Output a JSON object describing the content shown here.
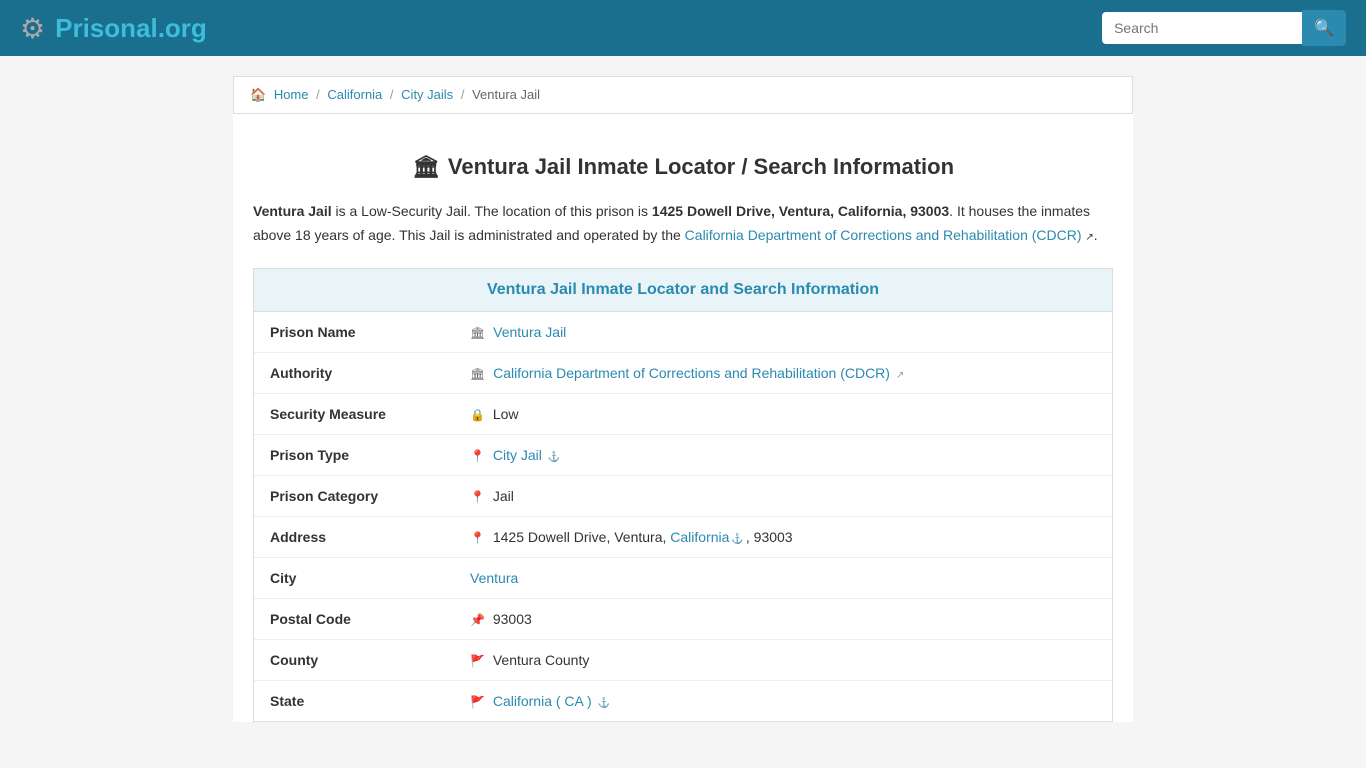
{
  "header": {
    "logo_name": "Prisonal",
    "logo_tld": ".org",
    "search_placeholder": "Search"
  },
  "breadcrumb": {
    "home": "Home",
    "california": "California",
    "city_jails": "City Jails",
    "current": "Ventura Jail"
  },
  "page_title": "Ventura Jail Inmate Locator / Search Information",
  "description": {
    "part1": "Ventura Jail",
    "part2": " is a Low-Security Jail. The location of this prison is ",
    "address_bold": "1425 Dowell Drive, Ventura, California, 93003",
    "part3": ". It houses the inmates above 18 years of age. This Jail is administrated and operated by the ",
    "authority_link": "California Department of Corrections and Rehabilitation (CDCR)",
    "part4": "."
  },
  "info_section": {
    "header": "Ventura Jail Inmate Locator and Search Information",
    "rows": [
      {
        "label": "Prison Name",
        "value": "Ventura Jail",
        "link": true,
        "icon": "🏛"
      },
      {
        "label": "Authority",
        "value": "California Department of Corrections and Rehabilitation (CDCR)",
        "link": true,
        "icon": "🏛",
        "ext": true
      },
      {
        "label": "Security Measure",
        "value": "Low",
        "link": false,
        "icon": "🔒"
      },
      {
        "label": "Prison Type",
        "value": "City Jail",
        "link": true,
        "icon": "📍",
        "anchor": true
      },
      {
        "label": "Prison Category",
        "value": "Jail",
        "link": false,
        "icon": "📍"
      },
      {
        "label": "Address",
        "value": "1425 Dowell Drive, Ventura, California",
        "value2": ", 93003",
        "link": false,
        "icon": "📍",
        "state_link": "California"
      },
      {
        "label": "City",
        "value": "Ventura",
        "link": true,
        "icon": ""
      },
      {
        "label": "Postal Code",
        "value": "93003",
        "link": false,
        "icon": "📌"
      },
      {
        "label": "County",
        "value": "Ventura County",
        "link": false,
        "icon": "🚩"
      },
      {
        "label": "State",
        "value": "California ( CA )",
        "link": true,
        "icon": "🚩",
        "anchor": true
      }
    ]
  }
}
